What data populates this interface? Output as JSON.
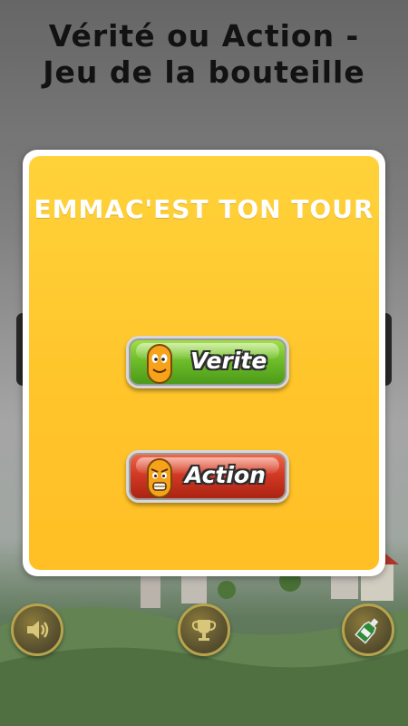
{
  "app": {
    "title_line1": "Vérité ou Action -",
    "title_line2": "Jeu de la bouteille"
  },
  "modal": {
    "turn_text": "EMMAC'EST TON TOUR",
    "truth_button": "Verite",
    "dare_button": "Action"
  },
  "bottom_bar": {
    "sound_icon": "speaker-icon",
    "trophy_icon": "trophy-icon",
    "bottle_icon": "bottle-icon"
  },
  "colors": {
    "modal_yellow": "#ffc52b",
    "truth_green": "#6fbe2a",
    "dare_red": "#d23a24"
  }
}
